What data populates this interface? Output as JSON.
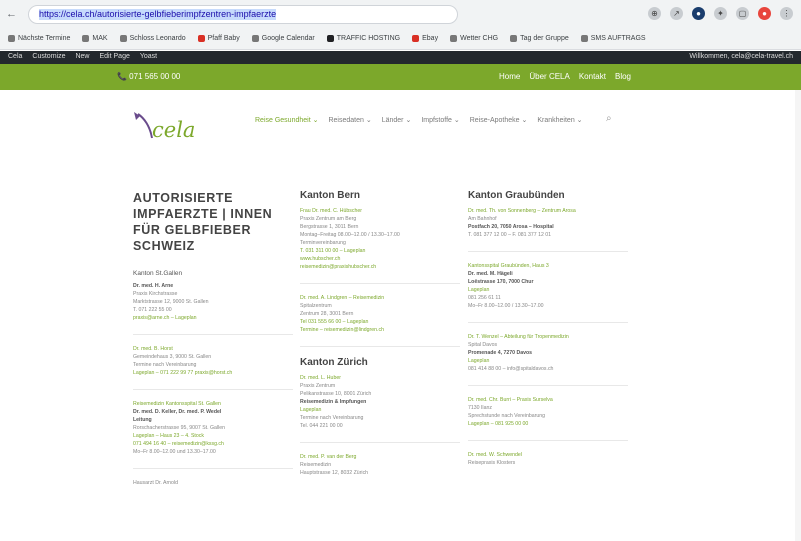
{
  "browser": {
    "url": "https://cela.ch/autorisierte-gelbfieberimpfzentren-impfaerzte",
    "back": "←",
    "bookmarks": [
      {
        "label": "Nächste Termine"
      },
      {
        "label": "MAK"
      },
      {
        "label": "Schloss Leonardo"
      },
      {
        "label": "Pfaff Baby"
      },
      {
        "label": "Google Calendar"
      },
      {
        "label": "TRAFFIC HOSTING"
      },
      {
        "label": "Ebay"
      },
      {
        "label": "Wetter CHG"
      },
      {
        "label": "Tag der Gruppe"
      },
      {
        "label": "SMS AUFTRAGS"
      }
    ]
  },
  "wp_admin": {
    "left_items": [
      "Cela",
      "Customize",
      "New",
      "Edit Page",
      "Yoast"
    ],
    "right_text": "Willkommen, cela@cela-travel.ch"
  },
  "site_header": {
    "phone": "📞 071 565 00 00",
    "links": [
      "Home",
      "Über CELA",
      "Kontakt",
      "Blog"
    ]
  },
  "logo": {
    "text": "cela"
  },
  "nav": {
    "items": [
      {
        "label": "Reise Gesundheit ⌄",
        "active": true
      },
      {
        "label": "Reisedaten ⌄",
        "active": false
      },
      {
        "label": "Länder ⌄",
        "active": false
      },
      {
        "label": "Impfstoffe ⌄",
        "active": false
      },
      {
        "label": "Reise-Apotheke ⌄",
        "active": false
      },
      {
        "label": "Krankheiten ⌄",
        "active": false
      }
    ],
    "search_icon": "search-icon"
  },
  "content": {
    "main_title": "AUTORISIERTE IMPFAERZTE | INNEN FÜR GELBFIEBER SCHWEIZ",
    "col1": {
      "canton_label": "Kanton St.Gallen",
      "entries": [
        {
          "lines": [
            "Dr. med. H. Arne",
            "Praxis Kirchstrasse",
            "Marktstrasse 12, 9000 St. Gallen",
            "T. 071 222 55 00",
            "praxis@arne.ch – Lageplan"
          ]
        },
        {
          "lines": [
            "Dr. med. B. Horst",
            "Gemeindehaus 3, 9000 St. Gallen",
            "Termine nach Vereinbarung",
            "Lageplan – 071 222 99 77 praxis@horst.ch"
          ]
        },
        {
          "lines": [
            "Reisemedizin Kantonsspital St. Gallen",
            "Dr. med. D. Keller, Dr. med. P. Wedel",
            "Leitung",
            "Rorschacherstrasse 95, 9007 St. Gallen",
            "Lageplan – Haus 23 – 4. Stock",
            "071 494 16 40 – reisemedizin@kssg.ch",
            "Mo–Fr 8.00–12.00 und 13.30–17.00"
          ]
        },
        {
          "lines": [
            "Hausarzt Dr. Arnold"
          ]
        }
      ]
    },
    "col2": {
      "canton1": "Kanton Bern",
      "bern_entries": [
        {
          "lines": [
            "Frau Dr. med. C. Hübscher",
            "Praxis Zentrum am Berg",
            "Bergstrasse 1, 3011 Bern",
            "Montag–Freitag 08.00–12.00 / 13.30–17.00",
            "Terminvereinbarung",
            "T. 031 311 00 00 – Lageplan",
            "www.hubscher.ch",
            "reisemedizin@praxishubscher.ch"
          ]
        },
        {
          "lines": [
            "Dr. med. A. Lindgren – Reisemedizin",
            "Spitalzentrum",
            "Zentrum 28, 3001 Bern",
            "Tel 031 555 66 00 – Lageplan",
            "Termine – reisemedizin@lindgren.ch"
          ]
        }
      ],
      "canton2": "Kanton Zürich",
      "zurich_entries": [
        {
          "lines": [
            "Dr. med. L. Huber",
            "Praxis Zentrum",
            "Pelikanstrasse 10, 8001 Zürich",
            "Reisemedizin & Impfungen",
            "Lageplan",
            "Termine nach Vereinbarung",
            "Tel. 044 221 00 00"
          ]
        },
        {
          "lines": [
            "Dr. med. P. van der Berg",
            "Reisemedizin",
            "Hauptstrasse 12, 8032 Zürich"
          ]
        }
      ]
    },
    "col3": {
      "canton_label": "Kanton Graubünden",
      "entries": [
        {
          "lines": [
            "Dr. med. Th. von Sonnenberg – Zentrum Arosa",
            "Am Bahnhof",
            "Postfach 20, 7050 Arosa – Hospital",
            "T. 081 377 12 00 – F. 081 377 12 01"
          ]
        },
        {
          "lines": [
            "Kantonsspital Graubünden, Haus 3",
            "Dr. med. M. Hägeli",
            "Loëstrasse 170, 7000 Chur",
            "Lageplan",
            "081 256 61 11",
            "Mo–Fr 8.00–12.00 / 13.30–17.00"
          ]
        },
        {
          "lines": [
            "Dr. T. Wenzel – Abteilung für Tropenmedizin",
            "Spital Davos",
            "Promenade 4, 7270 Davos",
            "Lageplan",
            "081 414 88 00 – info@spitaldavos.ch"
          ]
        },
        {
          "lines": [
            "Dr. med. Chr. Burri – Praxis Surselva",
            "7130 Ilanz",
            "Sprechstunde nach Vereinbarung",
            "Lageplan – 081 925 00 00"
          ]
        },
        {
          "lines": [
            "Dr. med. W. Schwendel",
            "Reisepraxis Klosters"
          ]
        }
      ]
    }
  }
}
